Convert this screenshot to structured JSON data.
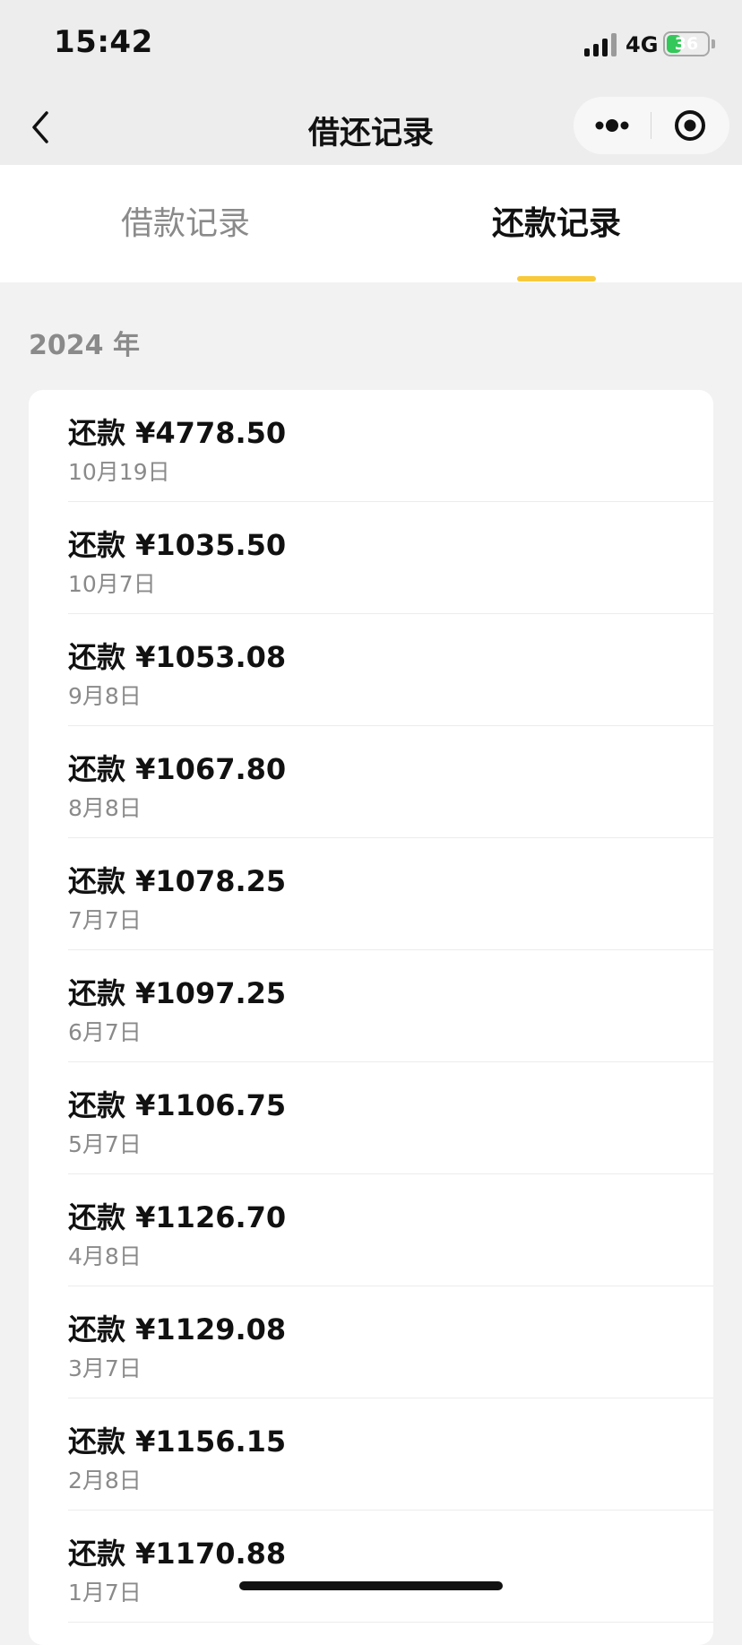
{
  "status_bar": {
    "time": "15:42",
    "network": "4G",
    "battery": "36",
    "battery_level": 0.36
  },
  "nav": {
    "title": "借还记录",
    "back_icon": "chevron-left-icon",
    "more_icon": "more-dots-icon",
    "close_icon": "target-circle-icon"
  },
  "tabs": [
    {
      "label": "借款记录",
      "active": false
    },
    {
      "label": "还款记录",
      "active": true
    }
  ],
  "colors": {
    "accent": "#f8c93a",
    "battery_green": "#34c759"
  },
  "year_header": "2024 年",
  "records": [
    {
      "title": "还款 ¥4778.50",
      "date": "10月19日"
    },
    {
      "title": "还款 ¥1035.50",
      "date": "10月7日"
    },
    {
      "title": "还款 ¥1053.08",
      "date": "9月8日"
    },
    {
      "title": "还款 ¥1067.80",
      "date": "8月8日"
    },
    {
      "title": "还款 ¥1078.25",
      "date": "7月7日"
    },
    {
      "title": "还款 ¥1097.25",
      "date": "6月7日"
    },
    {
      "title": "还款 ¥1106.75",
      "date": "5月7日"
    },
    {
      "title": "还款 ¥1126.70",
      "date": "4月8日"
    },
    {
      "title": "还款 ¥1129.08",
      "date": "3月7日"
    },
    {
      "title": "还款 ¥1156.15",
      "date": "2月8日"
    },
    {
      "title": "还款 ¥1170.88",
      "date": "1月7日"
    }
  ]
}
